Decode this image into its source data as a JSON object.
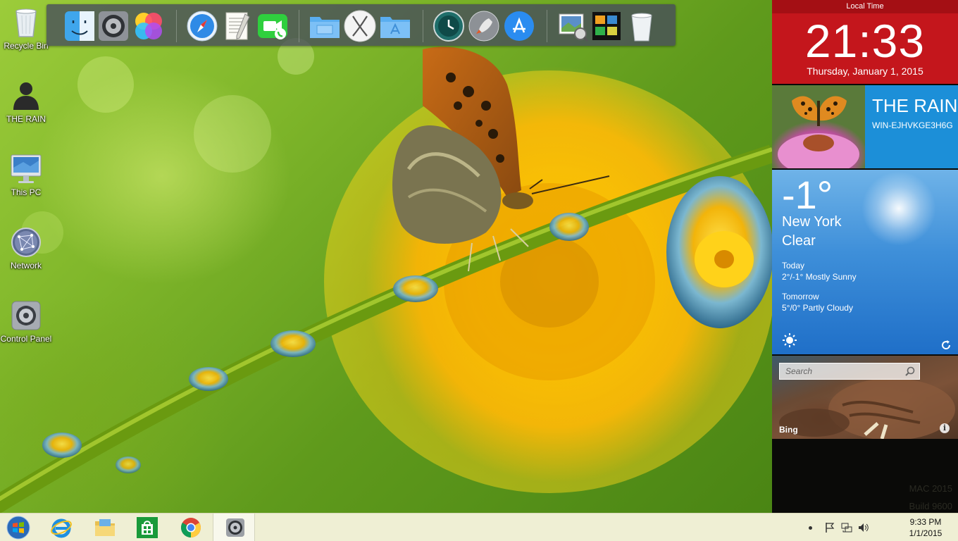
{
  "desktop": {
    "icons": [
      {
        "label": "Recycle Bin"
      },
      {
        "label": "THE RAIN"
      },
      {
        "label": "This PC"
      },
      {
        "label": "Network"
      },
      {
        "label": "Control Panel"
      }
    ]
  },
  "dock": {
    "apps": [
      "finder-icon",
      "system-preferences-icon",
      "game-center-icon",
      "safari-icon",
      "textedit-icon",
      "facetime-icon",
      "documents-folder-icon",
      "osx-x-icon",
      "applications-folder-icon",
      "time-machine-icon",
      "launchpad-icon",
      "app-store-icon",
      "preview-icon",
      "photo-booth-icon",
      "trash-icon"
    ]
  },
  "clock_tile": {
    "header": "Local Time",
    "time": "21:33",
    "date": "Thursday, January 1, 2015"
  },
  "user_tile": {
    "name": "THE RAIN",
    "computer": "WIN-EJHVKGE3H6G"
  },
  "weather": {
    "temperature": "-1°",
    "city": "New York",
    "condition": "Clear",
    "today_label": "Today",
    "today_forecast": "2°/-1° Mostly Sunny",
    "tomorrow_label": "Tomorrow",
    "tomorrow_forecast": "5°/0° Partly Cloudy"
  },
  "bing": {
    "search_placeholder": "Search",
    "label": "Bing",
    "info": "i"
  },
  "watermark": {
    "line1": "MAC 2015",
    "line2": "Build 9600"
  },
  "taskbar": {
    "pinned": [
      "start-button",
      "internet-explorer-icon",
      "file-explorer-icon",
      "windows-store-icon",
      "chrome-icon",
      "settings-gear-icon"
    ],
    "time": "9:33 PM",
    "date": "1/1/2015"
  },
  "colors": {
    "clock_tile": "#c4161c",
    "user_tile": "#1c8fd8",
    "weather_tile": "#3e8fd9",
    "taskbar": "#efefd4"
  }
}
